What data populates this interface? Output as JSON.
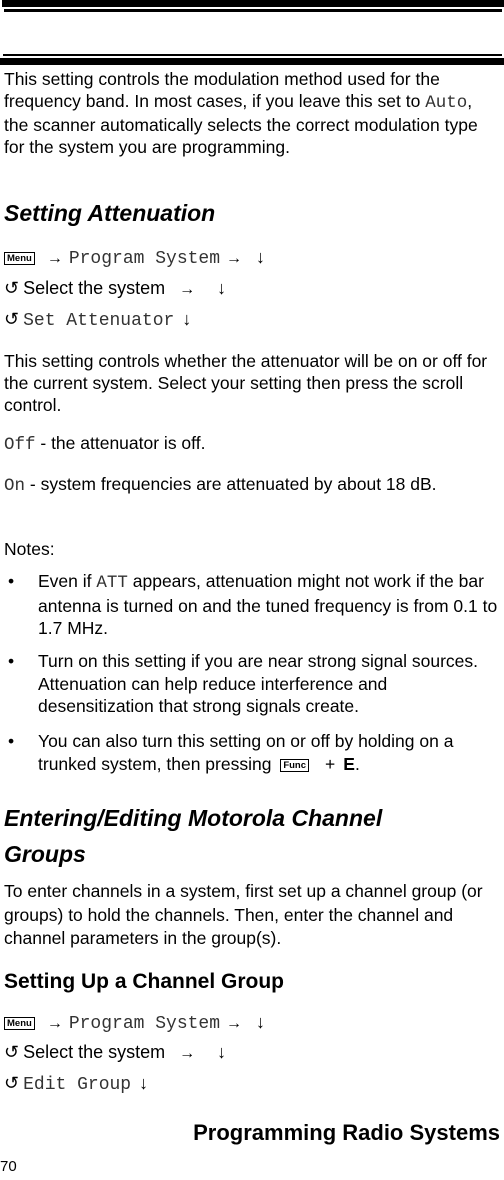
{
  "intro_paragraph": {
    "before": "This setting controls the modulation method used for the frequency band. In most cases, if you leave this set to ",
    "code": "Auto",
    "after": ", the scanner automatically selects the correct modulation type for the system you are programming."
  },
  "section_attenuation": {
    "title": "Setting Attenuation",
    "steps": [
      {
        "key": "Menu",
        "text": "Program System"
      },
      {
        "text": "Select the system"
      },
      {
        "code": "Set Attenuator"
      }
    ],
    "description": "This setting controls whether the attenuator will be on or off for the current system. Select your setting then press the scroll control.",
    "options": [
      {
        "code": "Off",
        "text": " - the attenuator is off."
      },
      {
        "code": "On",
        "text": " - system frequencies are attenuated by about 18 dB."
      }
    ],
    "notes_label": "Notes:",
    "notes": [
      {
        "before": "Even if ",
        "code": "ATT",
        "after": " appears, attenuation might not work if the bar antenna is turned on and the tuned frequency is from 0.1 to 1.7 MHz."
      },
      {
        "text": "Turn on this setting if you are near strong signal sources. Attenuation can help reduce interference and desensitization that strong signals create."
      },
      {
        "before": "You can also turn this setting on or off by holding on a trunked system, then pressing ",
        "key": "Func",
        "plus": "+",
        "letter": "E",
        "end": "."
      }
    ]
  },
  "section_motorola": {
    "title": "Entering/Editing Motorola Channel Groups",
    "description": "To enter channels in a system, first set up a channel group (or groups) to hold the channels. Then, enter the channel and channel parameters in the group(s)."
  },
  "section_channel_group": {
    "title": "Setting Up a Channel Group",
    "steps": [
      {
        "key": "Menu",
        "text": "Program System"
      },
      {
        "text": "Select the system"
      },
      {
        "code": "Edit Group"
      }
    ]
  },
  "symbols": {
    "arrow_right": "→",
    "arrow_down": "↓",
    "rotate": "↺",
    "bullet": "•"
  },
  "footer": {
    "chapter_title": "Programming Radio Systems",
    "page_number": "70"
  }
}
